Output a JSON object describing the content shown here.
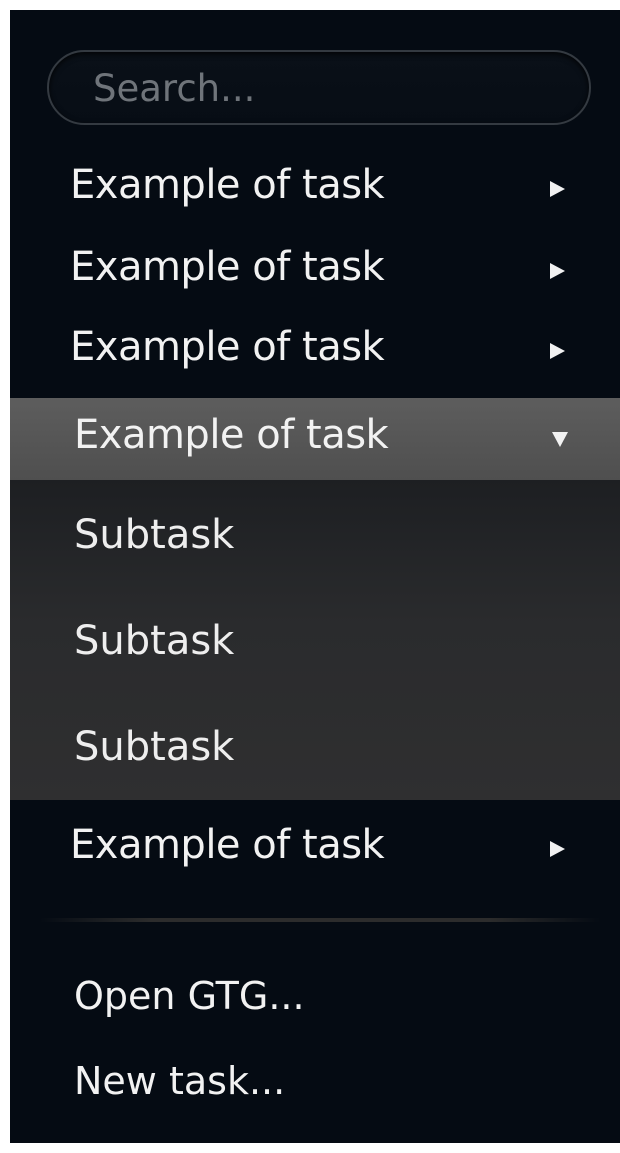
{
  "search": {
    "placeholder": "Search..."
  },
  "tasks": [
    {
      "label": "Example of task",
      "expanded": false
    },
    {
      "label": "Example of task",
      "expanded": false
    },
    {
      "label": "Example of task",
      "expanded": false
    },
    {
      "label": "Example of task",
      "expanded": true,
      "subtasks": [
        {
          "label": "Subtask"
        },
        {
          "label": "Subtask"
        },
        {
          "label": "Subtask"
        }
      ]
    },
    {
      "label": "Example of task",
      "expanded": false
    }
  ],
  "actions": {
    "open": "Open GTG...",
    "new_task": "New task..."
  },
  "icons": {
    "collapsed": "triangle-right-icon",
    "expanded": "triangle-down-icon"
  },
  "colors": {
    "background": "#050b13",
    "highlight": "#5a5a5a",
    "submenu": "#2b2b2c",
    "text": "#f2f2f2"
  }
}
